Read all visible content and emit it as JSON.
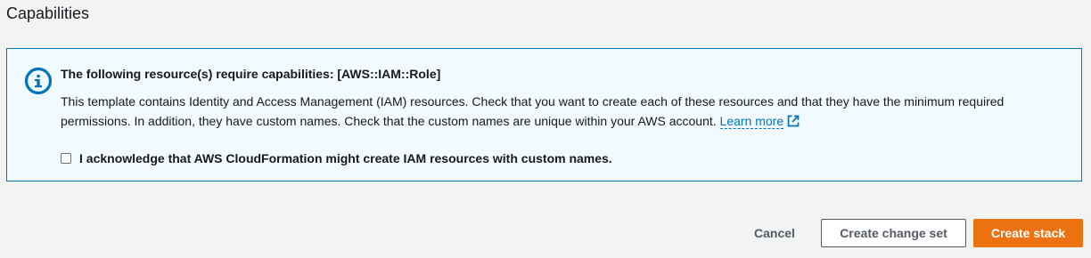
{
  "section": {
    "title": "Capabilities"
  },
  "alert": {
    "icon": "info-icon",
    "heading": "The following resource(s) require capabilities: [AWS::IAM::Role]",
    "body": "This template contains Identity and Access Management (IAM) resources. Check that you want to create each of these resources and that they have the minimum required permissions. In addition, they have custom names. Check that the custom names are unique within your AWS account. ",
    "learn_more": "Learn more",
    "learn_more_icon": "external-link-icon",
    "ack_checked": false,
    "ack_label": "I acknowledge that AWS CloudFormation might create IAM resources with custom names."
  },
  "actions": {
    "cancel": "Cancel",
    "create_change_set": "Create change set",
    "create_stack": "Create stack"
  },
  "colors": {
    "background": "#f2f3f3",
    "info_accent": "#0073bb",
    "info_background": "#f1faff",
    "primary_button": "#ec7211",
    "secondary_text": "#545b64"
  }
}
